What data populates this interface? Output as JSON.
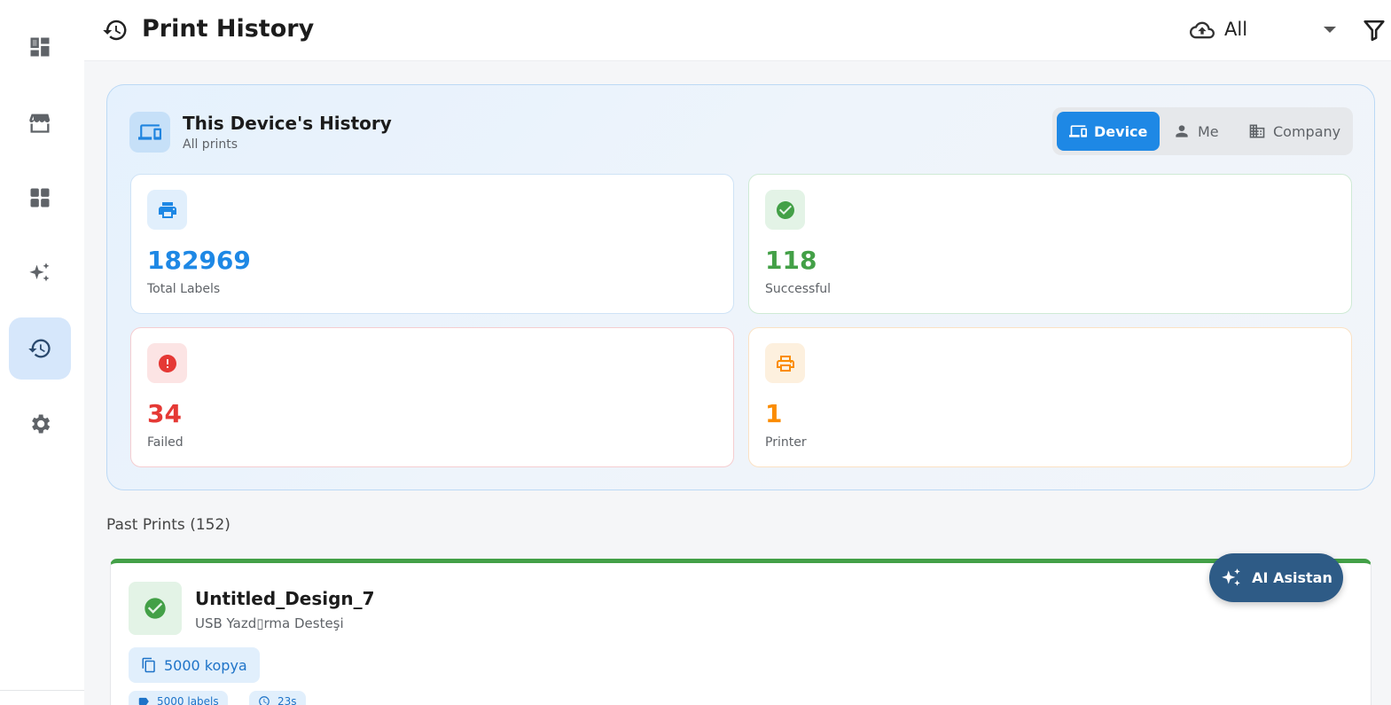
{
  "sidebar": {
    "items": [
      {
        "icon": "dashboard-icon",
        "active": false
      },
      {
        "icon": "store-icon",
        "active": false
      },
      {
        "icon": "grid-icon",
        "active": false
      },
      {
        "icon": "sparkles-icon",
        "active": false
      },
      {
        "icon": "history-icon",
        "active": true
      },
      {
        "icon": "gear-icon",
        "active": false
      }
    ]
  },
  "header": {
    "title": "Print History",
    "filter_value": "All",
    "icons": [
      "history-icon",
      "cloud-upload-icon",
      "chevron-down-icon",
      "filter-icon"
    ]
  },
  "summary": {
    "title": "This Device's History",
    "subtitle": "All prints",
    "scope_tabs": [
      {
        "label": "Device",
        "icon": "devices-icon",
        "active": true
      },
      {
        "label": "Me",
        "icon": "person-icon",
        "active": false
      },
      {
        "label": "Company",
        "icon": "building-icon",
        "active": false
      }
    ],
    "stats": [
      {
        "value": "182969",
        "label": "Total Labels",
        "color": "#1e88e5",
        "icon": "printer-icon"
      },
      {
        "value": "118",
        "label": "Successful",
        "color": "#43a047",
        "icon": "check-circle-icon"
      },
      {
        "value": "34",
        "label": "Failed",
        "color": "#e53935",
        "icon": "error-icon"
      },
      {
        "value": "1",
        "label": "Printer",
        "color": "#fb8c00",
        "icon": "printer-outline-icon"
      }
    ]
  },
  "past_prints": {
    "title": "Past Prints (152)",
    "items": [
      {
        "name": "Untitled_Design_7",
        "printer": "USB Yazd▯rma Desteşi",
        "status": "success",
        "copies": "5000 kopya",
        "labels": "5000 labels",
        "duration": "23s"
      }
    ]
  },
  "ai_button": {
    "label": "AI Asistan",
    "icon": "sparkles-icon"
  },
  "colors": {
    "accent": "#1e88e5",
    "success": "#43a047",
    "danger": "#e53935",
    "warning": "#fb8c00",
    "ai": "#2e5b86"
  }
}
